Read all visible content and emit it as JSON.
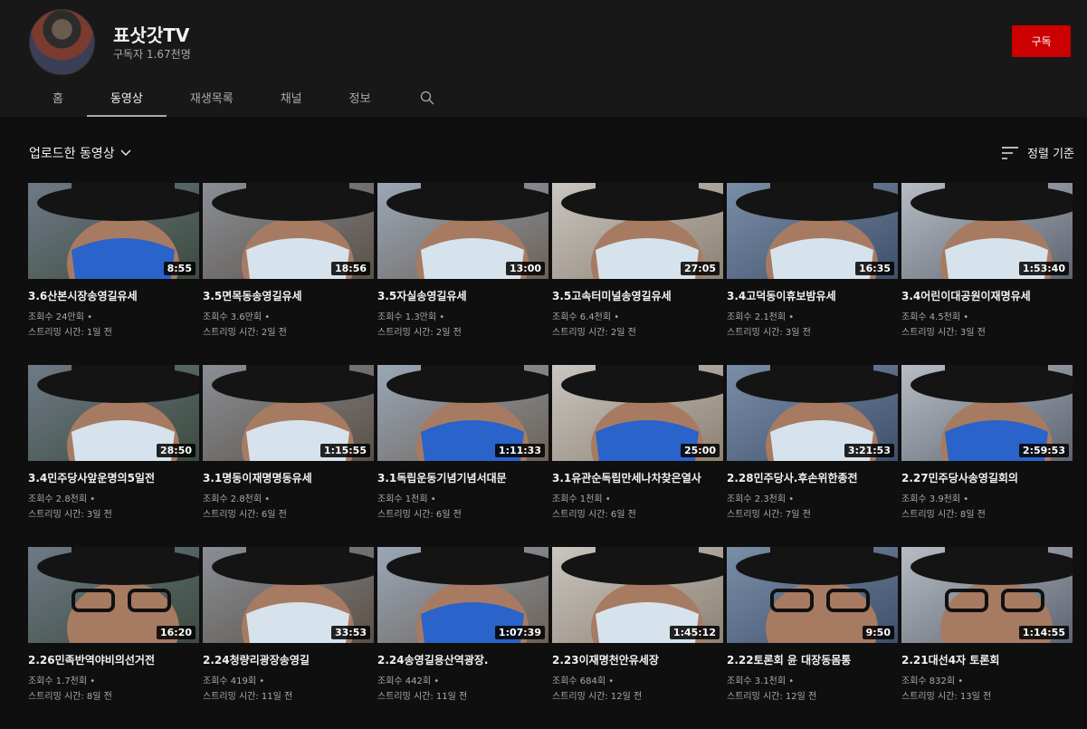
{
  "channel": {
    "name": "표삿갓TV",
    "subscribers": "구독자 1.67천명",
    "subscribe_label": "구독"
  },
  "tabs": [
    {
      "label": "홈"
    },
    {
      "label": "동영상"
    },
    {
      "label": "재생목록"
    },
    {
      "label": "채널"
    },
    {
      "label": "정보"
    }
  ],
  "section": {
    "title": "업로드한 동영상",
    "sort_label": "정렬 기준"
  },
  "icons": {
    "search": "search-icon",
    "sort": "sort-icon",
    "dropdown": "chevron-down-icon"
  },
  "colors": {
    "background": "#0f0f0f",
    "header": "#181818",
    "subscribe": "#cc0000",
    "meta_text": "#aaaaaa"
  },
  "videos": [
    {
      "title": "3.6산본시장송영길유세",
      "duration": "8:55",
      "views": "조회수 24만회 •",
      "streamed": "스트리밍 시간: 1일 전",
      "mask": "blue"
    },
    {
      "title": "3.5면목동송영길유세",
      "duration": "18:56",
      "views": "조회수 3.6만회 •",
      "streamed": "스트리밍 시간: 2일 전",
      "mask": "white"
    },
    {
      "title": "3.5자실송영길유세",
      "duration": "13:00",
      "views": "조회수 1.3만회 •",
      "streamed": "스트리밍 시간: 2일 전",
      "mask": "white"
    },
    {
      "title": "3.5고속터미널송영길유세",
      "duration": "27:05",
      "views": "조회수 6.4천회 •",
      "streamed": "스트리밍 시간: 2일 전",
      "mask": "white"
    },
    {
      "title": "3.4고덕동이휴보밤유세",
      "duration": "16:35",
      "views": "조회수 2.1천회 •",
      "streamed": "스트리밍 시간: 3일 전",
      "mask": "white"
    },
    {
      "title": "3.4어린이대공원이재명유세",
      "duration": "1:53:40",
      "views": "조회수 4.5천회 •",
      "streamed": "스트리밍 시간: 3일 전",
      "mask": "white"
    },
    {
      "title": "3.4민주당사앞운명의5일전",
      "duration": "28:50",
      "views": "조회수 2.8천회 •",
      "streamed": "스트리밍 시간: 3일 전",
      "mask": "white"
    },
    {
      "title": "3.1명동이재명명동유세",
      "duration": "1:15:55",
      "views": "조회수 2.8천회 •",
      "streamed": "스트리밍 시간: 6일 전",
      "mask": "white"
    },
    {
      "title": "3.1독립운동기념기념서대문",
      "duration": "1:11:33",
      "views": "조회수 1천회 •",
      "streamed": "스트리밍 시간: 6일 전",
      "mask": "blue"
    },
    {
      "title": "3.1유관순독립만세나차찾은열사",
      "duration": "25:00",
      "views": "조회수 1천회 •",
      "streamed": "스트리밍 시간: 6일 전",
      "mask": "blue"
    },
    {
      "title": "2.28민주당사.후손위한종전",
      "duration": "3:21:53",
      "views": "조회수 2.3천회 •",
      "streamed": "스트리밍 시간: 7일 전",
      "mask": "white"
    },
    {
      "title": "2.27민주당사송영길회의",
      "duration": "2:59:53",
      "views": "조회수 3.9천회 •",
      "streamed": "스트리밍 시간: 8일 전",
      "mask": "blue"
    },
    {
      "title": "2.26민족반역야비의선거전",
      "duration": "16:20",
      "views": "조회수 1.7천회 •",
      "streamed": "스트리밍 시간: 8일 전",
      "mask": "none"
    },
    {
      "title": "2.24청량리광장송영길",
      "duration": "33:53",
      "views": "조회수 419회 •",
      "streamed": "스트리밍 시간: 11일 전",
      "mask": "white"
    },
    {
      "title": "2.24송영길용산역광장.",
      "duration": "1:07:39",
      "views": "조회수 442회 •",
      "streamed": "스트리밍 시간: 11일 전",
      "mask": "blue"
    },
    {
      "title": "2.23이재명천안유세장",
      "duration": "1:45:12",
      "views": "조회수 684회 •",
      "streamed": "스트리밍 시간: 12일 전",
      "mask": "white"
    },
    {
      "title": "2.22토론회 윤 대장동몸통",
      "duration": "9:50",
      "views": "조회수 3.1천회 •",
      "streamed": "스트리밍 시간: 12일 전",
      "mask": "none"
    },
    {
      "title": "2.21대선4자 토론회",
      "duration": "1:14:55",
      "views": "조회수 832회 •",
      "streamed": "스트리밍 시간: 13일 전",
      "mask": "none"
    }
  ]
}
